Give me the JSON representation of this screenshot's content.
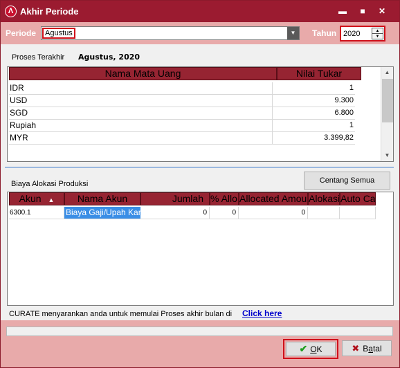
{
  "window": {
    "title": "Akhir Periode",
    "icon_glyph": "Λ",
    "controls": {
      "minimize": "▬",
      "maximize": "■",
      "close": "✕"
    }
  },
  "periode": {
    "label": "Periode",
    "value": "Agustus",
    "dropdown_icon": "▼"
  },
  "tahun": {
    "label": "Tahun",
    "value": "2020",
    "spin_up": "▲",
    "spin_down": "▼"
  },
  "proses_terakhir": {
    "label": "Proses Terakhir",
    "value": "Agustus, 2020"
  },
  "currency_grid": {
    "columns": [
      "Nama Mata Uang",
      "Nilai Tukar"
    ],
    "rows": [
      {
        "name": "IDR",
        "rate": "1"
      },
      {
        "name": "USD",
        "rate": "9.300"
      },
      {
        "name": "SGD",
        "rate": "6.800"
      },
      {
        "name": "Rupiah",
        "rate": "1"
      },
      {
        "name": "MYR",
        "rate": "3.399,82"
      }
    ],
    "scroll_up": "▲",
    "scroll_down": "▼"
  },
  "centang_semua": "Centang Semua",
  "biaya": {
    "label": "Biaya Alokasi Produksi",
    "columns": [
      "Akun",
      "Nama Akun",
      "Jumlah",
      "% Allo",
      "Allocated Amount",
      "Alokasi",
      "Auto Cal"
    ],
    "sort_icon": "▲",
    "rows": [
      {
        "akun": "6300.1",
        "nama": "Biaya Gaji/Upah Kary",
        "jumlah": "0",
        "allo": "0",
        "allocated": "0",
        "alokasi": "",
        "auto": ""
      }
    ]
  },
  "info": {
    "text": "CURATE menyarankan anda untuk memulai Proses akhir bulan di",
    "link": "Click here"
  },
  "buttons": {
    "ok": "OK",
    "ok_underline": "O",
    "ok_rest": "K",
    "batal_pre": "B",
    "batal_underline": "a",
    "batal_rest": "tal",
    "ok_icon": "✔",
    "batal_icon": "✖"
  },
  "colors": {
    "titlebar": "#9b1b30",
    "band": "#e8aaaa",
    "grid_header": "#962432",
    "highlight": "#d0101a",
    "selection": "#3a8ee6"
  }
}
